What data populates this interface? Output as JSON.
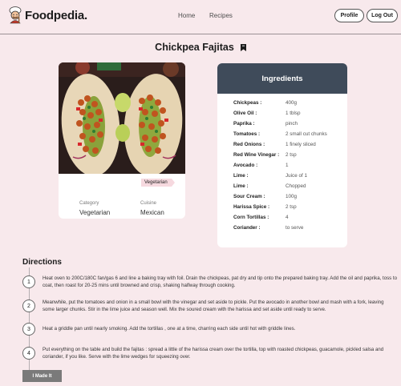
{
  "brand": {
    "name": "Foodpedia."
  },
  "nav": {
    "home": "Home",
    "recipes": "Recipes"
  },
  "header_buttons": {
    "profile": "Profile",
    "logout": "Log Out"
  },
  "recipe": {
    "title": "Chickpea Fajitas",
    "tag": "Vegetarian",
    "category_label": "Category",
    "category_value": "Vegetarian",
    "cuisine_label": "Cuisine",
    "cuisine_value": "Mexican"
  },
  "ingredients": {
    "heading": "Ingredients",
    "items": [
      {
        "name": "Chickpeas :",
        "amount": "400g"
      },
      {
        "name": "Olive Oil :",
        "amount": "1 tblsp"
      },
      {
        "name": "Paprika :",
        "amount": "pinch"
      },
      {
        "name": "Tomatoes :",
        "amount": "2 small cut chunks"
      },
      {
        "name": "Red Onions :",
        "amount": "1 finely sliced"
      },
      {
        "name": "Red Wine Vinegar :",
        "amount": "2 tsp"
      },
      {
        "name": "Avocado :",
        "amount": "1"
      },
      {
        "name": "Lime :",
        "amount": "Juice of 1"
      },
      {
        "name": "Lime :",
        "amount": "Chopped"
      },
      {
        "name": "Sour Cream :",
        "amount": "100g"
      },
      {
        "name": "Harissa Spice :",
        "amount": "2 tsp"
      },
      {
        "name": "Corn Tortillas :",
        "amount": "4"
      },
      {
        "name": "Coriander :",
        "amount": "to serve"
      }
    ]
  },
  "directions": {
    "heading": "Directions",
    "steps": [
      {
        "num": "1",
        "text": "Heat oven to 200C/180C fan/gas 6 and line a baking tray with foil. Drain the chickpeas, pat dry and tip onto the prepared baking tray. Add the oil and paprika, toss to coat, then roast for 20-25 mins until browned and crisp, shaking halfway through cooking."
      },
      {
        "num": "2",
        "text": "Meanwhile, put the tomatoes and onion in a small bowl with the vinegar and set aside to pickle. Put the avocado in another bowl and mash with a fork, leaving some larger chunks. Stir in the lime juice and season well. Mix the soured cream with the harissa and set aside until ready to serve."
      },
      {
        "num": "3",
        "text": "Heat a griddle pan until nearly smoking. Add the tortillas , one at a time, charring each side until hot with griddle lines."
      },
      {
        "num": "4",
        "text": "Put everything on the table and build the fajitas : spread a little of the harissa cream over the tortilla, top with roasted chickpeas, guacamole, pickled salsa and coriander, if you like. Serve with the lime wedges for squeezing over."
      }
    ],
    "made_it_label": "I Made It"
  },
  "colors": {
    "page_bg": "#f8e9ec",
    "ingredients_header_bg": "#3f4b5a",
    "tag_bg": "#f6d9df",
    "made_it_button_bg": "#7a7a7a"
  },
  "icons": {
    "logo": "chef-icon",
    "bookmark": "bookmark-icon"
  }
}
